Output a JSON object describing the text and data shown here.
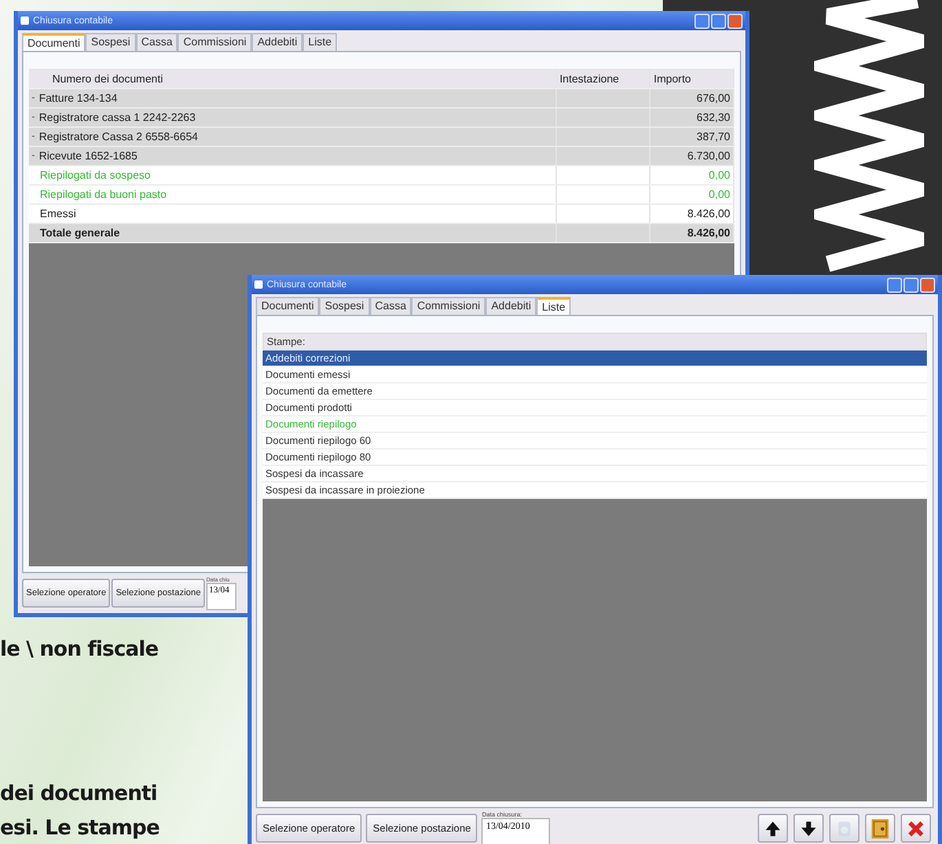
{
  "background_text": [
    "le \\ non fiscale",
    "dei documenti",
    "esi. Le stampe"
  ],
  "windows": [
    {
      "title": "Chiusura contabile",
      "tabs": [
        {
          "label": "Documenti",
          "selected": true
        },
        {
          "label": "Sospesi",
          "selected": false
        },
        {
          "label": "Cassa",
          "selected": false
        },
        {
          "label": "Commissioni",
          "selected": false
        },
        {
          "label": "Addebiti",
          "selected": false
        },
        {
          "label": "Liste",
          "selected": false
        }
      ],
      "table": {
        "columns": [
          "Numero dei documenti",
          "Intestazione",
          "Importo"
        ],
        "rows": [
          {
            "kind": "group",
            "expander": "-",
            "name": "Fatture 134-134",
            "amount": "676,00"
          },
          {
            "kind": "group",
            "expander": "-",
            "name": "Registratore cassa 1 2242-2263",
            "amount": "632,30"
          },
          {
            "kind": "group",
            "expander": "-",
            "name": "Registratore Cassa 2 6558-6654",
            "amount": "387,70"
          },
          {
            "kind": "group",
            "expander": "-",
            "name": "Ricevute 1652-1685",
            "amount": "6.730,00"
          },
          {
            "kind": "summary",
            "name": "Riepilogati da sospeso",
            "amount": "0,00"
          },
          {
            "kind": "summary",
            "name": "Riepilogati da buoni pasto",
            "amount": "0,00"
          },
          {
            "kind": "plain",
            "name": "Emessi",
            "amount": "8.426,00"
          },
          {
            "kind": "total",
            "name": "Totale generale",
            "amount": "8.426,00"
          }
        ]
      },
      "buttons": [
        "Selezione operatore",
        "Selezione postazione"
      ],
      "date_field": {
        "label": "Data chiu",
        "value": "13/04"
      }
    },
    {
      "title": "Chiusura contabile",
      "tabs": [
        {
          "label": "Documenti",
          "selected": false
        },
        {
          "label": "Sospesi",
          "selected": false
        },
        {
          "label": "Cassa",
          "selected": false
        },
        {
          "label": "Commissioni",
          "selected": false
        },
        {
          "label": "Addebiti",
          "selected": false
        },
        {
          "label": "Liste",
          "selected": true
        }
      ],
      "list": {
        "header": "Stampe:",
        "items": [
          {
            "label": "Addebiti correzioni",
            "selected": true
          },
          {
            "label": "Documenti emessi",
            "selected": false,
            "color": "#333333"
          },
          {
            "label": "Documenti da emettere",
            "selected": false,
            "color": "#333333"
          },
          {
            "label": "Documenti prodotti",
            "selected": false,
            "color": "#333333"
          },
          {
            "label": "Documenti riepilogo",
            "selected": false,
            "color": "#33bb33"
          },
          {
            "label": "Documenti riepilogo 60",
            "selected": false,
            "color": "#333333"
          },
          {
            "label": "Documenti riepilogo 80",
            "selected": false,
            "color": "#333333"
          },
          {
            "label": "Sospesi da incassare",
            "selected": false,
            "color": "#333333"
          },
          {
            "label": "Sospesi da incassare in proiezione",
            "selected": false,
            "color": "#333333"
          }
        ]
      },
      "buttons": [
        "Selezione operatore",
        "Selezione postazione"
      ],
      "date_field": {
        "label": "Data chiusura:",
        "value": "13/04/2010"
      },
      "toolbar": [
        {
          "kind": "up",
          "disabled": false
        },
        {
          "kind": "down",
          "disabled": false
        },
        {
          "kind": "print",
          "disabled": true
        },
        {
          "kind": "safe",
          "disabled": false
        },
        {
          "kind": "close",
          "disabled": false
        }
      ]
    }
  ]
}
